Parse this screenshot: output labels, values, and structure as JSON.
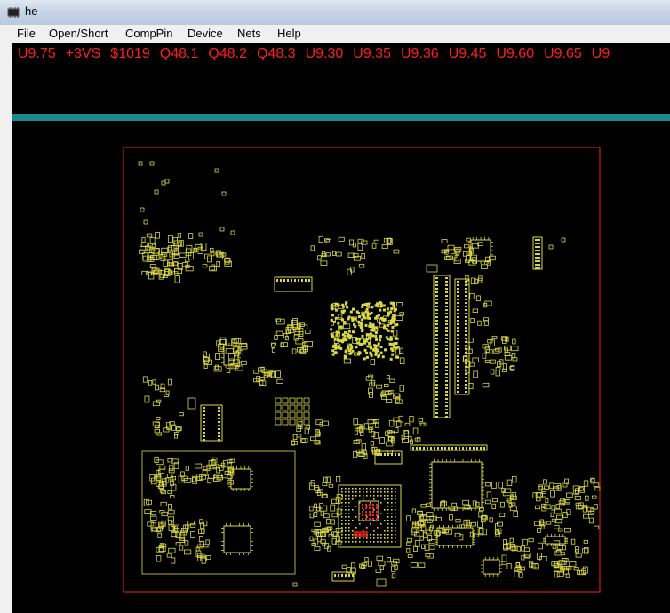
{
  "window": {
    "title": "he",
    "icon": "board-chip-icon"
  },
  "menu": {
    "items": [
      {
        "label": "File"
      },
      {
        "label": "Open/Short"
      },
      {
        "label": "CompPin"
      },
      {
        "label": "Device"
      },
      {
        "label": "Nets"
      },
      {
        "label": "Help"
      }
    ]
  },
  "net_list": {
    "color": "#ff1e1e",
    "labels": [
      "U9.75",
      "+3VS",
      "$1019",
      "Q48.1",
      "Q48.2",
      "Q48.3",
      "U9.30",
      "U9.35",
      "U9.36",
      "U9.45",
      "U9.60",
      "U9.65",
      "U9"
    ]
  },
  "board": {
    "outline_color": "#ff2020",
    "component_color": "#d8d84a",
    "highlight_color": "#ff2020",
    "background": "#000000"
  }
}
